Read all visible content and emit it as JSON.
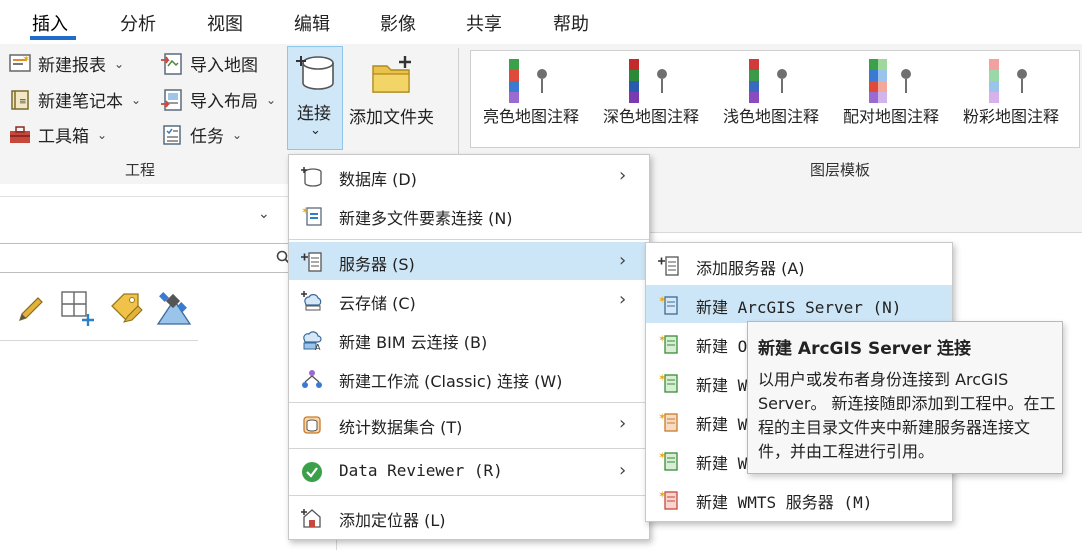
{
  "tabs": [
    "插入",
    "分析",
    "视图",
    "编辑",
    "影像",
    "共享",
    "帮助"
  ],
  "ribbon": {
    "project": {
      "new_report": "新建报表",
      "new_notebook": "新建笔记本",
      "toolbox": "工具箱",
      "import_map": "导入地图",
      "import_layout": "导入布局",
      "tasks": "任务",
      "connect": "连接",
      "add_folder": "添加文件夹",
      "group_label": "工程"
    },
    "layer_templates": {
      "items": [
        "亮色地图注释",
        "深色地图注释",
        "浅色地图注释",
        "配对地图注释",
        "粉彩地图注释"
      ],
      "group_label": "图层模板"
    }
  },
  "connect_menu": {
    "items": [
      {
        "label": "数据库 (D)",
        "has_sub": true
      },
      {
        "label": "新建多文件要素连接 (N)",
        "has_sub": false
      },
      {
        "label": "服务器 (S)",
        "has_sub": true
      },
      {
        "label": "云存储 (C)",
        "has_sub": true
      },
      {
        "label": "新建 BIM 云连接 (B)",
        "has_sub": false
      },
      {
        "label": "新建工作流 (Classic) 连接 (W)",
        "has_sub": false
      },
      {
        "label": "统计数据集合 (T)",
        "has_sub": true
      },
      {
        "label": "Data Reviewer (R)",
        "has_sub": true
      },
      {
        "label": "添加定位器 (L)",
        "has_sub": false
      }
    ]
  },
  "server_menu": {
    "items": [
      "添加服务器 (A)",
      "新建 ArcGIS Server (N)",
      "新建 O",
      "新建 W",
      "新建 W",
      "新建 W",
      "新建 WMTS 服务器 (M)"
    ]
  },
  "tooltip": {
    "title": "新建 ArcGIS Server 连接",
    "body": "以用户或发布者身份连接到 ArcGIS Server。 新连接随即添加到工程中。在工程的主目录文件夹中新建服务器连接文件，并由工程进行引用。"
  },
  "colors": {
    "accent": "#1e6dc8",
    "highlight": "#cde6f7",
    "ribbon_bg": "#f4f4f4"
  }
}
